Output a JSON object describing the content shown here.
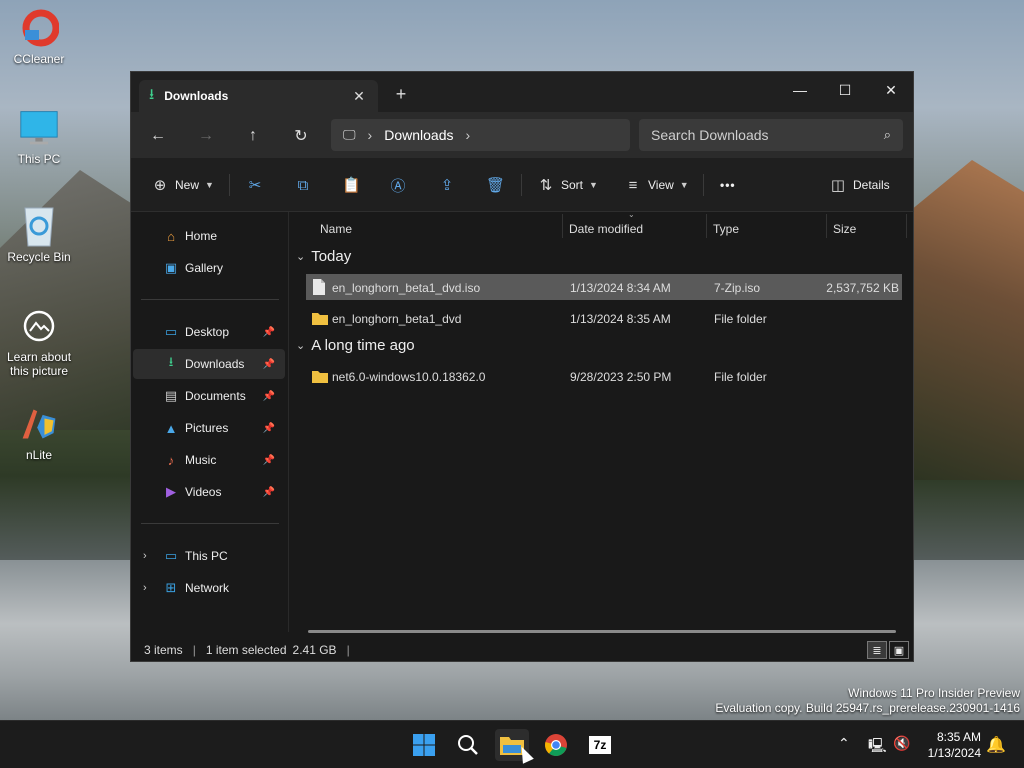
{
  "desktop": {
    "icons": [
      {
        "label": "CCleaner"
      },
      {
        "label": "This PC"
      },
      {
        "label": "Recycle Bin"
      },
      {
        "label": "Learn about this picture"
      },
      {
        "label": "nLite"
      }
    ],
    "watermark": {
      "line1": "Windows 11 Pro Insider Preview",
      "line2": "Evaluation copy. Build 25947.rs_prerelease.230901-1416"
    }
  },
  "explorer": {
    "tab": {
      "label": "Downloads",
      "close": "✕",
      "new_tab": "+"
    },
    "window_controls": {
      "minimize": "—",
      "maximize": "☐",
      "close": "✕"
    },
    "address": {
      "back": "←",
      "forward": "→",
      "up": "↑",
      "refresh": "↻",
      "path": [
        "Downloads"
      ],
      "search_placeholder": "Search Downloads"
    },
    "toolbar": {
      "new_label": "New",
      "sort_label": "Sort",
      "view_label": "View",
      "more_label": "•••",
      "details_label": "Details"
    },
    "sidebar": {
      "items": [
        {
          "label": "Home",
          "pinned": false
        },
        {
          "label": "Gallery",
          "pinned": false
        },
        {
          "label": "Desktop",
          "pinned": true
        },
        {
          "label": "Downloads",
          "pinned": true,
          "selected": true
        },
        {
          "label": "Documents",
          "pinned": true
        },
        {
          "label": "Pictures",
          "pinned": true
        },
        {
          "label": "Music",
          "pinned": true
        },
        {
          "label": "Videos",
          "pinned": true
        },
        {
          "label": "This PC",
          "expandable": true
        },
        {
          "label": "Network",
          "expandable": true
        }
      ]
    },
    "columns": {
      "name": "Name",
      "date": "Date modified",
      "type": "Type",
      "size": "Size"
    },
    "groups": [
      {
        "label": "Today",
        "rows": [
          {
            "name": "en_longhorn_beta1_dvd.iso",
            "date": "1/13/2024 8:34 AM",
            "type": "7-Zip.iso",
            "size": "2,537,752 KB",
            "selected": true,
            "kind": "file"
          },
          {
            "name": "en_longhorn_beta1_dvd",
            "date": "1/13/2024 8:35 AM",
            "type": "File folder",
            "size": "",
            "kind": "folder"
          }
        ]
      },
      {
        "label": "A long time ago",
        "rows": [
          {
            "name": "net6.0-windows10.0.18362.0",
            "date": "9/28/2023 2:50 PM",
            "type": "File folder",
            "size": "",
            "kind": "folder"
          }
        ]
      }
    ],
    "status": {
      "items": "3 items",
      "selected": "1 item selected",
      "size": "2.41 GB"
    }
  },
  "taskbar": {
    "clock_time": "8:35 AM",
    "clock_date": "1/13/2024",
    "apps": [
      "start-icon",
      "search-icon",
      "file-explorer-icon",
      "chrome-icon",
      "7zip-icon"
    ],
    "seven_zip_label": "7z"
  },
  "colors": {
    "accent": "#60a8e8",
    "folder": "#f0c040",
    "selected_row": "#5a5a5a"
  }
}
